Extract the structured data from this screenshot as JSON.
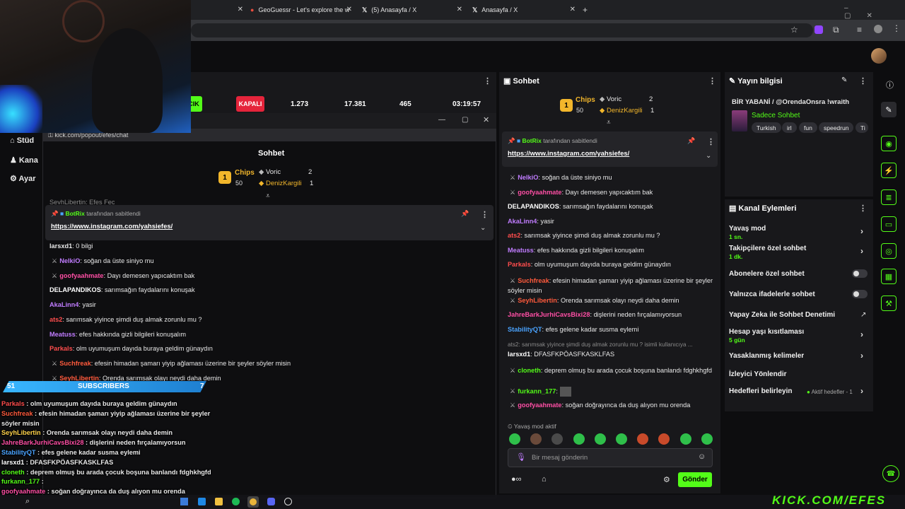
{
  "browser": {
    "tabs": [
      {
        "title": "GeoGuessr - Let's explore the w"
      },
      {
        "title": "(5) Anasayfa / X"
      },
      {
        "title": "Anasayfa / X"
      }
    ],
    "new_tab": "+"
  },
  "dashboard": {
    "sidebar_items": [
      "Stüd",
      "Kana",
      "Ayar"
    ],
    "stream_stats": {
      "live_badge": "CIK",
      "closed_badge": "KAPALI",
      "viewers": "1.273",
      "followers": "17.381",
      "subs": "465",
      "uptime": "03:19:57"
    },
    "chat": {
      "title": "Sohbet",
      "leaderboard": {
        "chips_label": "Chips",
        "chips_count": "50",
        "rank1": "1",
        "users": [
          {
            "name": "Voric",
            "count": "2"
          },
          {
            "name": "DenizKargili",
            "count": "1"
          }
        ]
      },
      "pinned": {
        "user": "BotRix",
        "suffix": "tarafından sabitlendi",
        "link": "https://www.instagram.com/yahsiefes/"
      },
      "messages": [
        {
          "user": "NelkiO",
          "color": "#c07cff",
          "text": "soğan da üste siniyo mu",
          "badge": true
        },
        {
          "user": "goofyaahmate",
          "color": "#ff4fa5",
          "text": "Dayı demesen yapıcaktım bak",
          "badge": true
        },
        {
          "user": "DELAPANDIKOS",
          "color": "#ffffff",
          "text": "sarımsağın faydalarını konuşak",
          "badge": false
        },
        {
          "user": "AkaLinn4",
          "color": "#c07cff",
          "text": "yasir",
          "badge": false
        },
        {
          "user": "ats2",
          "color": "#ff4d4d",
          "text": "sarımsak yiyince şimdi duş almak zorunlu mu ?",
          "badge": false
        },
        {
          "user": "Meatuss",
          "color": "#c07cff",
          "text": "efes hakkında gizli bilgileri konuşalım",
          "badge": false
        },
        {
          "user": "Parkals",
          "color": "#ff4d4d",
          "text": "olm uyumuşum dayıda buraya geldim günaydın",
          "badge": false
        },
        {
          "user": "Suchfreak",
          "color": "#ff5a3c",
          "text": "efesin himadan şamarı yiyip ağlaması üzerine bir şeyler söyler misin",
          "badge": true
        },
        {
          "user": "SeyhLibertin",
          "color": "#ff5a3c",
          "text": "Orenda sarımsak olayı neydi daha demin",
          "badge": true
        },
        {
          "user": "JahreBarkJurhiCavsBixi28",
          "color": "#ff4fa5",
          "text": "dişlerini neden fırçalamıyorsun",
          "badge": false
        },
        {
          "user": "StabilityQT",
          "color": "#4aa3ff",
          "text": "efes gelene kadar susma eylemi",
          "badge": false
        },
        {
          "user": "larsxd1",
          "color": "#ffffff",
          "text": "DFASFKPÖASFKASKLFAS",
          "badge": false
        },
        {
          "user": "cloneth",
          "color": "#53fc18",
          "text": "deprem olmuş bu arada çocuk boşuna banlandı fdghkhgfd",
          "badge": true
        },
        {
          "user": "furkann_177",
          "color": "#53fc18",
          "text": "",
          "badge": true
        },
        {
          "user": "goofyaahmate",
          "color": "#ff4fa5",
          "text": "soğan doğrayınca da duş alıyon mu orenda",
          "badge": true
        }
      ],
      "reply_preview": "ats2: sarımsak yiyince şimdi duş almak zorunlu mu ? isimli kullanıcıya ...",
      "slow_mode": "Yavaş mod aktif",
      "input_placeholder": "Bir mesaj gönderin",
      "send_label": "Gönder"
    },
    "stream_info": {
      "title": "Yayın bilgisi",
      "stream_title": "BİR YABANİ / @OrendaOnsra !wraith",
      "category": "Sadece Sohbet",
      "tags": [
        "Turkish",
        "irl",
        "fun",
        "speedrun",
        "Ti"
      ]
    },
    "channel_actions": {
      "title": "Kanal Eylemleri",
      "items": [
        {
          "label": "Yavaş mod",
          "sub": "1 sn.",
          "control": "chevron"
        },
        {
          "label": "Takipçilere özel sohbet",
          "sub": "1 dk.",
          "control": "chevron"
        },
        {
          "label": "Abonelere özel sohbet",
          "sub": "",
          "control": "toggle"
        },
        {
          "label": "Yalnızca ifadelerle sohbet",
          "sub": "",
          "control": "toggle"
        },
        {
          "label": "Yapay Zeka ile Sohbet Denetimi",
          "sub": "",
          "control": "external"
        },
        {
          "label": "Hesap yaşı kısıtlaması",
          "sub": "5 gün",
          "control": "chevron"
        },
        {
          "label": "Yasaklanmış kelimeler",
          "sub": "",
          "control": "chevron"
        },
        {
          "label": "İzleyici Yönlendir",
          "sub": "",
          "control": "none"
        },
        {
          "label": "Hedefleri belirleyin",
          "sub": "",
          "control": "chevron"
        }
      ],
      "goals_status": "Aktif hedefler - 1"
    }
  },
  "popout": {
    "url": "kick.com/popout/efes/chat",
    "title": "Sohbet",
    "top_cut_message": "SeyhLibertin: Efes Fec",
    "first_message": {
      "user": "larsxd1",
      "text": "0 bilgi"
    }
  },
  "overlay": {
    "sub_count": "51",
    "sub_label": "SUBSCRIBERS",
    "sub_goal": "7",
    "watermark": "KICK.COM/EFES",
    "lines": [
      {
        "user": "Parkals",
        "text": "olm uyumuşum dayıda buraya geldim günaydın"
      },
      {
        "user": "Suchfreak",
        "text": "efesin himadan şamarı yiyip ağlaması üzerine bir şeyler"
      },
      {
        "user": "",
        "text": "söyler misin"
      },
      {
        "user": "SeyhLibertin",
        "text": "Orenda sarımsak olayı neydi daha demin"
      },
      {
        "user": "JahreBarkJurhiCavsBixi28",
        "text": "dişlerini neden fırçalamıyorsun"
      },
      {
        "user": "StabilityQT",
        "text": "efes gelene kadar susma eylemi"
      },
      {
        "user": "larsxd1",
        "text": "DFASFKPÖASFKASKLFAS"
      },
      {
        "user": "cloneth",
        "text": "deprem olmuş bu arada çocuk boşuna banlandı fdghkhgfd"
      },
      {
        "user": "furkann_177",
        "text": ""
      },
      {
        "user": "goofyaahmate",
        "text": "soğan doğrayınca da duş alıyon mu orenda"
      }
    ]
  },
  "colors": {
    "kick_green": "#53fc18",
    "panel": "#18181b",
    "background": "#0d0d0f",
    "closed_red": "#e5243b"
  }
}
